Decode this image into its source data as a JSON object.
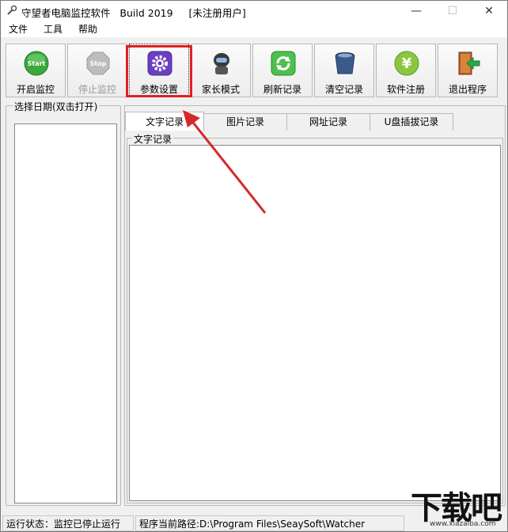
{
  "window": {
    "title": "守望者电脑监控软件   Build 2019     [未注册用户]",
    "minimize_glyph": "—",
    "maximize_glyph": "☐",
    "close_glyph": "✕"
  },
  "menu": {
    "items": [
      "文件",
      "工具",
      "帮助"
    ]
  },
  "toolbar": {
    "buttons": [
      {
        "label": "开启监控",
        "icon": "start-icon",
        "color": "#3aa83a"
      },
      {
        "label": "停止监控",
        "icon": "stop-icon",
        "color": "#a9a9a9"
      },
      {
        "label": "参数设置",
        "icon": "gear-icon",
        "color": "#6a3fc0"
      },
      {
        "label": "家长模式",
        "icon": "robot-icon",
        "color": "#3a3a3a"
      },
      {
        "label": "刷新记录",
        "icon": "refresh-icon",
        "color": "#3aa83a"
      },
      {
        "label": "清空记录",
        "icon": "trash-icon",
        "color": "#2a4a7a"
      },
      {
        "label": "软件注册",
        "icon": "yen-icon",
        "color": "#8cc63f"
      },
      {
        "label": "退出程序",
        "icon": "exit-icon",
        "color": "#b85a2a"
      }
    ]
  },
  "date_panel": {
    "title": "选择日期(双击打开)"
  },
  "tabs": {
    "items": [
      "文字记录",
      "图片记录",
      "网址记录",
      "U盘插拔记录"
    ],
    "active": "文字记录"
  },
  "text_group": {
    "title": "文字记录"
  },
  "status": {
    "run_state": "运行状态：监控已停止运行",
    "path": "程序当前路径:D:\\Program Files\\SeaySoft\\Watcher"
  },
  "watermark": {
    "main": "下载吧",
    "sub": "www.xiazaiba.com"
  },
  "colors": {
    "highlight": "#e02020",
    "arrow": "#d42a2a"
  }
}
